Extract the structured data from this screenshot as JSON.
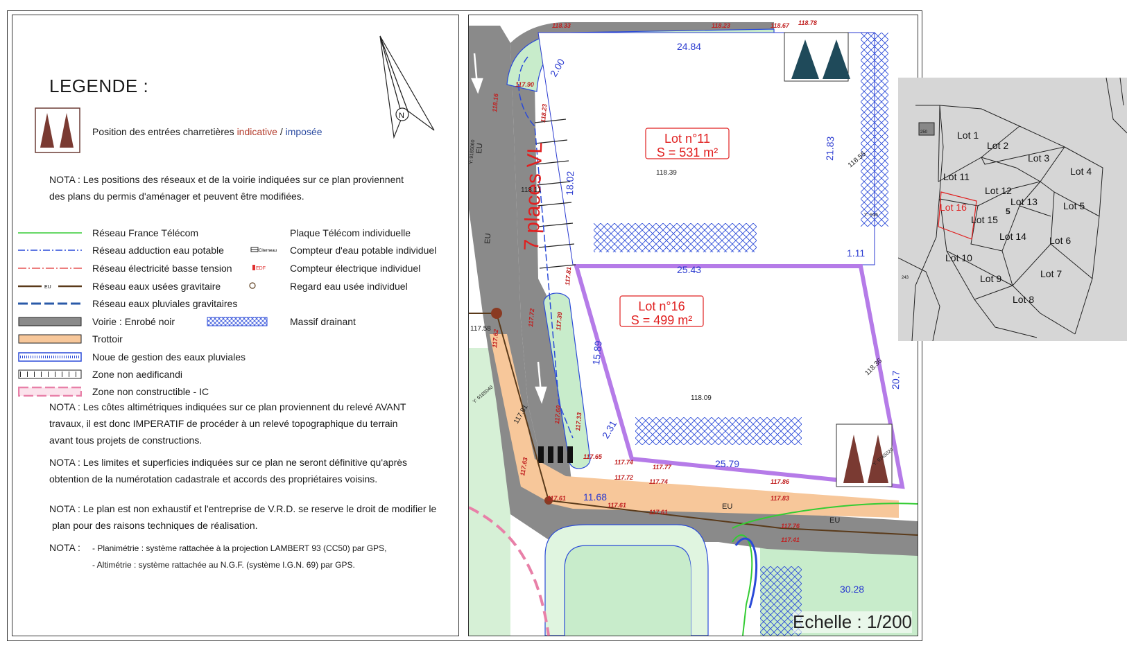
{
  "legend": {
    "title": "LEGENDE :",
    "entries_label_prefix": "Position des entrées charretières",
    "entries_indicative": "indicative",
    "entries_separator": " / ",
    "entries_imposed": "imposée",
    "nota1_line1": "NOTA : Les positions des réseaux et de la voirie indiquées sur ce plan proviennent",
    "nota1_line2": "des plans du permis d'aménager et peuvent être modifiées.",
    "items_left": [
      {
        "label": "Réseau France Télécom",
        "color": "#33cc33"
      },
      {
        "label": "Réseau adduction eau potable",
        "color": "#2a4ad8"
      },
      {
        "label": "Réseau électricité basse tension",
        "color": "#e03030"
      },
      {
        "label": "Réseau eaux usées gravitaire",
        "color": "#5a3a1a",
        "tag": "EU"
      },
      {
        "label": "Réseau eaux pluviales gravitaires",
        "color": "#2a5aa8"
      },
      {
        "label": "Voirie : Enrobé noir",
        "color": "#8a8a8a"
      },
      {
        "label": "Trottoir",
        "color": "#f7c79a"
      },
      {
        "label": "Noue de gestion des eaux pluviales",
        "color": "#2a4ad8"
      },
      {
        "label": "Zone non aedificandi",
        "color": "#333333"
      },
      {
        "label": "Zone non constructible - IC",
        "color": "#e880a8"
      }
    ],
    "items_right": [
      {
        "label": "Plaque Télécom individuelle"
      },
      {
        "label": "Compteur d'eau potable individuel",
        "tag": "Citerneau"
      },
      {
        "label": "Compteur électrique individuel",
        "tag": "EDF"
      },
      {
        "label": "Regard eau usée individuel"
      },
      {
        "label": "Massif drainant",
        "color": "#2a4ad8"
      }
    ],
    "nota2_line1": "NOTA : Les côtes altimétriques indiquées sur ce plan proviennent du relevé AVANT",
    "nota2_line2": "travaux, il est donc IMPERATIF de procéder à un relevé topographique du terrain",
    "nota2_line3": "avant tous projets de constructions.",
    "nota3_line1": "NOTA : Les limites et superficies indiquées sur ce plan ne seront définitive qu'après",
    "nota3_line2": "obtention de la numérotation cadastrale et accords des propriétaires voisins.",
    "nota4_line1": "NOTA : Le plan est non exhaustif et l'entreprise de V.R.D. se reserve le droit de modifier le",
    "nota4_line2": "plan pour des raisons techniques de réalisation.",
    "nota5_label": "NOTA :",
    "nota5_line1": "- Planimétrie : système rattachée à la projection LAMBERT 93 (CC50) par GPS,",
    "nota5_line2": "- Altimétrie : système rattachée au N.G.F. (système I.G.N. 69) par GPS.",
    "north_letter": "N"
  },
  "plan": {
    "lot11_title": "Lot n°11",
    "lot11_area": "S = 531 m²",
    "lot16_title": "Lot n°16",
    "lot16_area": "S = 499 m²",
    "parking_label": "7 places VL",
    "scale_label": "Echelle : 1/200",
    "dimensions": [
      "24.84",
      "18.02",
      "21.83",
      "25.43",
      "15.89",
      "25.79",
      "30.28",
      "2.00",
      "1.11",
      "2.31",
      "11.68",
      "20.7"
    ],
    "elevations_red": [
      "118.33",
      "118.23",
      "118.67",
      "118.78",
      "117.90",
      "118.16",
      "118.23",
      "117.72",
      "117.39",
      "117.81",
      "117.60",
      "117.33",
      "117.65",
      "117.74",
      "117.77",
      "117.72",
      "117.74",
      "117.61",
      "117.61",
      "117.61",
      "117.86",
      "117.83",
      "117.76",
      "117.41",
      "117.62",
      "117.63"
    ],
    "elevations_black": [
      "118.39",
      "118.11",
      "118.55",
      "118.09",
      "117.58",
      "117.81",
      "118.36"
    ],
    "network_tags": [
      "EU",
      "EU",
      "EU",
      "EU"
    ],
    "coords": [
      "Y: 9165060",
      "Y: 9165040",
      "Y: 9165020",
      "Y: 916"
    ],
    "alert_colors": {
      "lot_label": "#e02020",
      "dimension": "#2a3ad0",
      "lot16_outline": "#b57be8",
      "road": "#8a8a8a",
      "sidewalk": "#f7c79a",
      "green": "#c8eccb"
    }
  },
  "inset": {
    "lots": [
      "Lot 1",
      "Lot 2",
      "Lot 3",
      "Lot 4",
      "Lot 5",
      "Lot 6",
      "Lot 7",
      "Lot 8",
      "Lot 9",
      "Lot 10",
      "Lot 11",
      "Lot 12",
      "Lot 13",
      "Lot 14",
      "Lot 15",
      "Lot 16"
    ],
    "highlight": "Lot 16",
    "parcel_numbers": [
      "250",
      "243"
    ],
    "marker": "5"
  }
}
